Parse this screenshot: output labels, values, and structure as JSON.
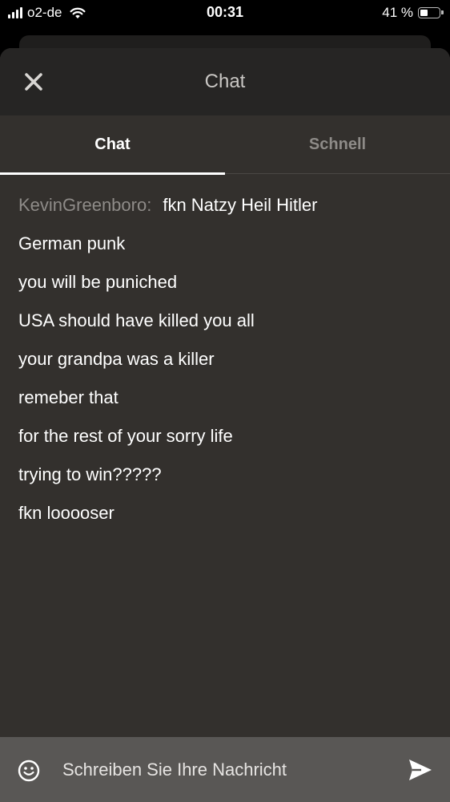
{
  "status_bar": {
    "carrier": "o2-de",
    "time": "00:31",
    "battery_text": "41 %",
    "battery_level": 0.41,
    "signal_bars": 4
  },
  "header": {
    "title": "Chat",
    "close_icon": "close-icon"
  },
  "tabs": [
    {
      "label": "Chat",
      "active": true
    },
    {
      "label": "Schnell",
      "active": false
    }
  ],
  "messages": [
    {
      "user": "KevinGreenboro:",
      "text": "fkn Natzy Heil Hitler"
    },
    {
      "text": "German punk"
    },
    {
      "text": "you will be puniched"
    },
    {
      "text": "USA should have killed you all"
    },
    {
      "text": "your grandpa was a killer"
    },
    {
      "text": "remeber that"
    },
    {
      "text": "for the rest of your sorry life"
    },
    {
      "text": "trying to win?????"
    },
    {
      "text": "fkn looooser"
    }
  ],
  "composer": {
    "placeholder": "Schreiben Sie Ihre Nachricht",
    "value": "",
    "emoji_icon": "smiley-icon",
    "send_icon": "send-icon"
  },
  "colors": {
    "sheet_bg": "#33302d",
    "header_bg": "#262524",
    "composer_bg": "#595755",
    "muted_text": "#8e8b88"
  }
}
